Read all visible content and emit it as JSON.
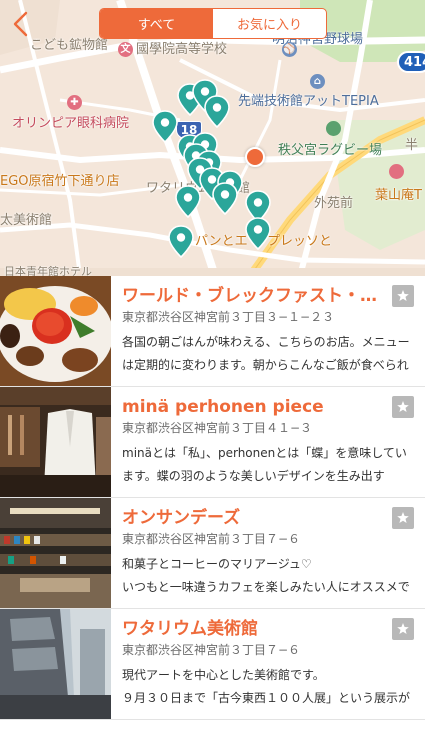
{
  "nav": {
    "tabs": [
      {
        "label": "すべて",
        "active": true
      },
      {
        "label": "お気に入り",
        "active": false
      }
    ]
  },
  "map": {
    "labels": {
      "kodomo": "こども鉱物館",
      "kokugakuin": "國學院高等学校",
      "meiji_stadium": "明治神宮野球場",
      "olympia": "オリンピア眼科病院",
      "sentan": "先端技術館アットTEPIA",
      "harajuku_takeshita": "EGO原宿竹下通り店",
      "chichibunomiya": "秩父宮ラグビー場",
      "watari": "ワタリウム美術館",
      "gaienmae": "外苑前",
      "hayama": "葉山庵T",
      "bijutsukan": "太美術館",
      "pan_to": "パンとエ",
      "pan_to_espresso": "プレッソと",
      "hanmon": "半",
      "bottom_strip": "日本青年館ホテル"
    },
    "route_number": "18",
    "expressway_number": "414",
    "poi_icons": {
      "hospital": "✚",
      "school": "文",
      "stadium": "⚾",
      "museum": "⌂"
    },
    "colors": {
      "accent": "#ee6a3a",
      "pin": "#2ba69a"
    }
  },
  "spots": [
    {
      "title": "ワールド・ブレックファスト・オールデイ",
      "address": "東京都渋谷区神宮前３丁目３−１−２３",
      "description": "各国の朝ごはんが味わえる、こちらのお店。メニューは定期的に変わります。朝からこんなご飯が食べられたら",
      "thumbnail": "breakfast-plate-photo"
    },
    {
      "title": "minä perhonen piece",
      "address": "東京都渋谷区神宮前３丁目４１−３",
      "description": "minäとは「私」、perhonenとは「蝶」を意味しています。蝶の羽のような美しいデザインを生み出す",
      "thumbnail": "boutique-interior-photo"
    },
    {
      "title": "オンサンデーズ",
      "address": "東京都渋谷区神宮前３丁目７−６",
      "description": "和菓子とコーヒーのマリアージュ♡\nいつもと一味違うカフェを楽しみたい人にオススメです",
      "thumbnail": "bookstore-photo"
    },
    {
      "title": "ワタリウム美術館",
      "address": "東京都渋谷区神宮前３丁目７−６",
      "description": "現代アートを中心とした美術館です。\n９月３０日まで「古今東西１００人展」という展示が開催中",
      "thumbnail": "museum-building-photo"
    }
  ]
}
